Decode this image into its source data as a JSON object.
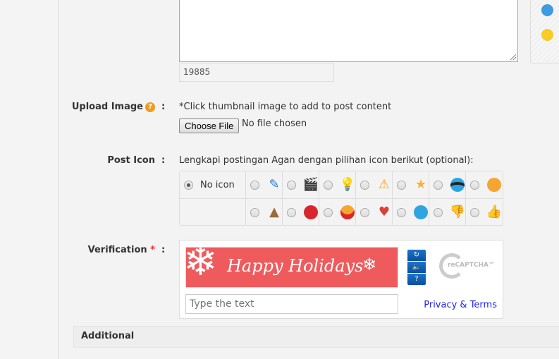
{
  "editor": {
    "char_count": "19885"
  },
  "upload": {
    "label": "Upload Image",
    "help_icon": "question-circle-icon",
    "colon": ":",
    "hint": "*Click thumbnail image to add to post content",
    "button": "Choose File",
    "status": "No file chosen"
  },
  "post_icon": {
    "label": "Post Icon",
    "colon": ":",
    "hint": "Lengkapi postingan Agan dengan pilihan icon berikut (optional):",
    "no_icon": "No icon",
    "selected": "No icon",
    "row1": [
      "pencil-icon",
      "clapperboard-icon",
      "lightbulb-icon",
      "warning-icon",
      "star-icon",
      "cool-sunglasses-icon",
      "smile-icon"
    ],
    "row2": [
      "poop-icon",
      "clown-laugh-icon",
      "laugh-icon",
      "heart-icon",
      "grin-icon",
      "thumbs-down-icon",
      "thumbs-up-icon"
    ]
  },
  "verification": {
    "label": "Verification",
    "required": "*",
    "colon": ":",
    "captcha_text": "Happy Holidays",
    "placeholder": "Type the text",
    "privacy": "Privacy & Terms",
    "logo": "reCAPTCHA™"
  },
  "additional": {
    "title": "Additional"
  },
  "colors": {
    "captcha_bg": "#ef5b5d",
    "link": "#2323ee",
    "help": "#f29a1a"
  }
}
